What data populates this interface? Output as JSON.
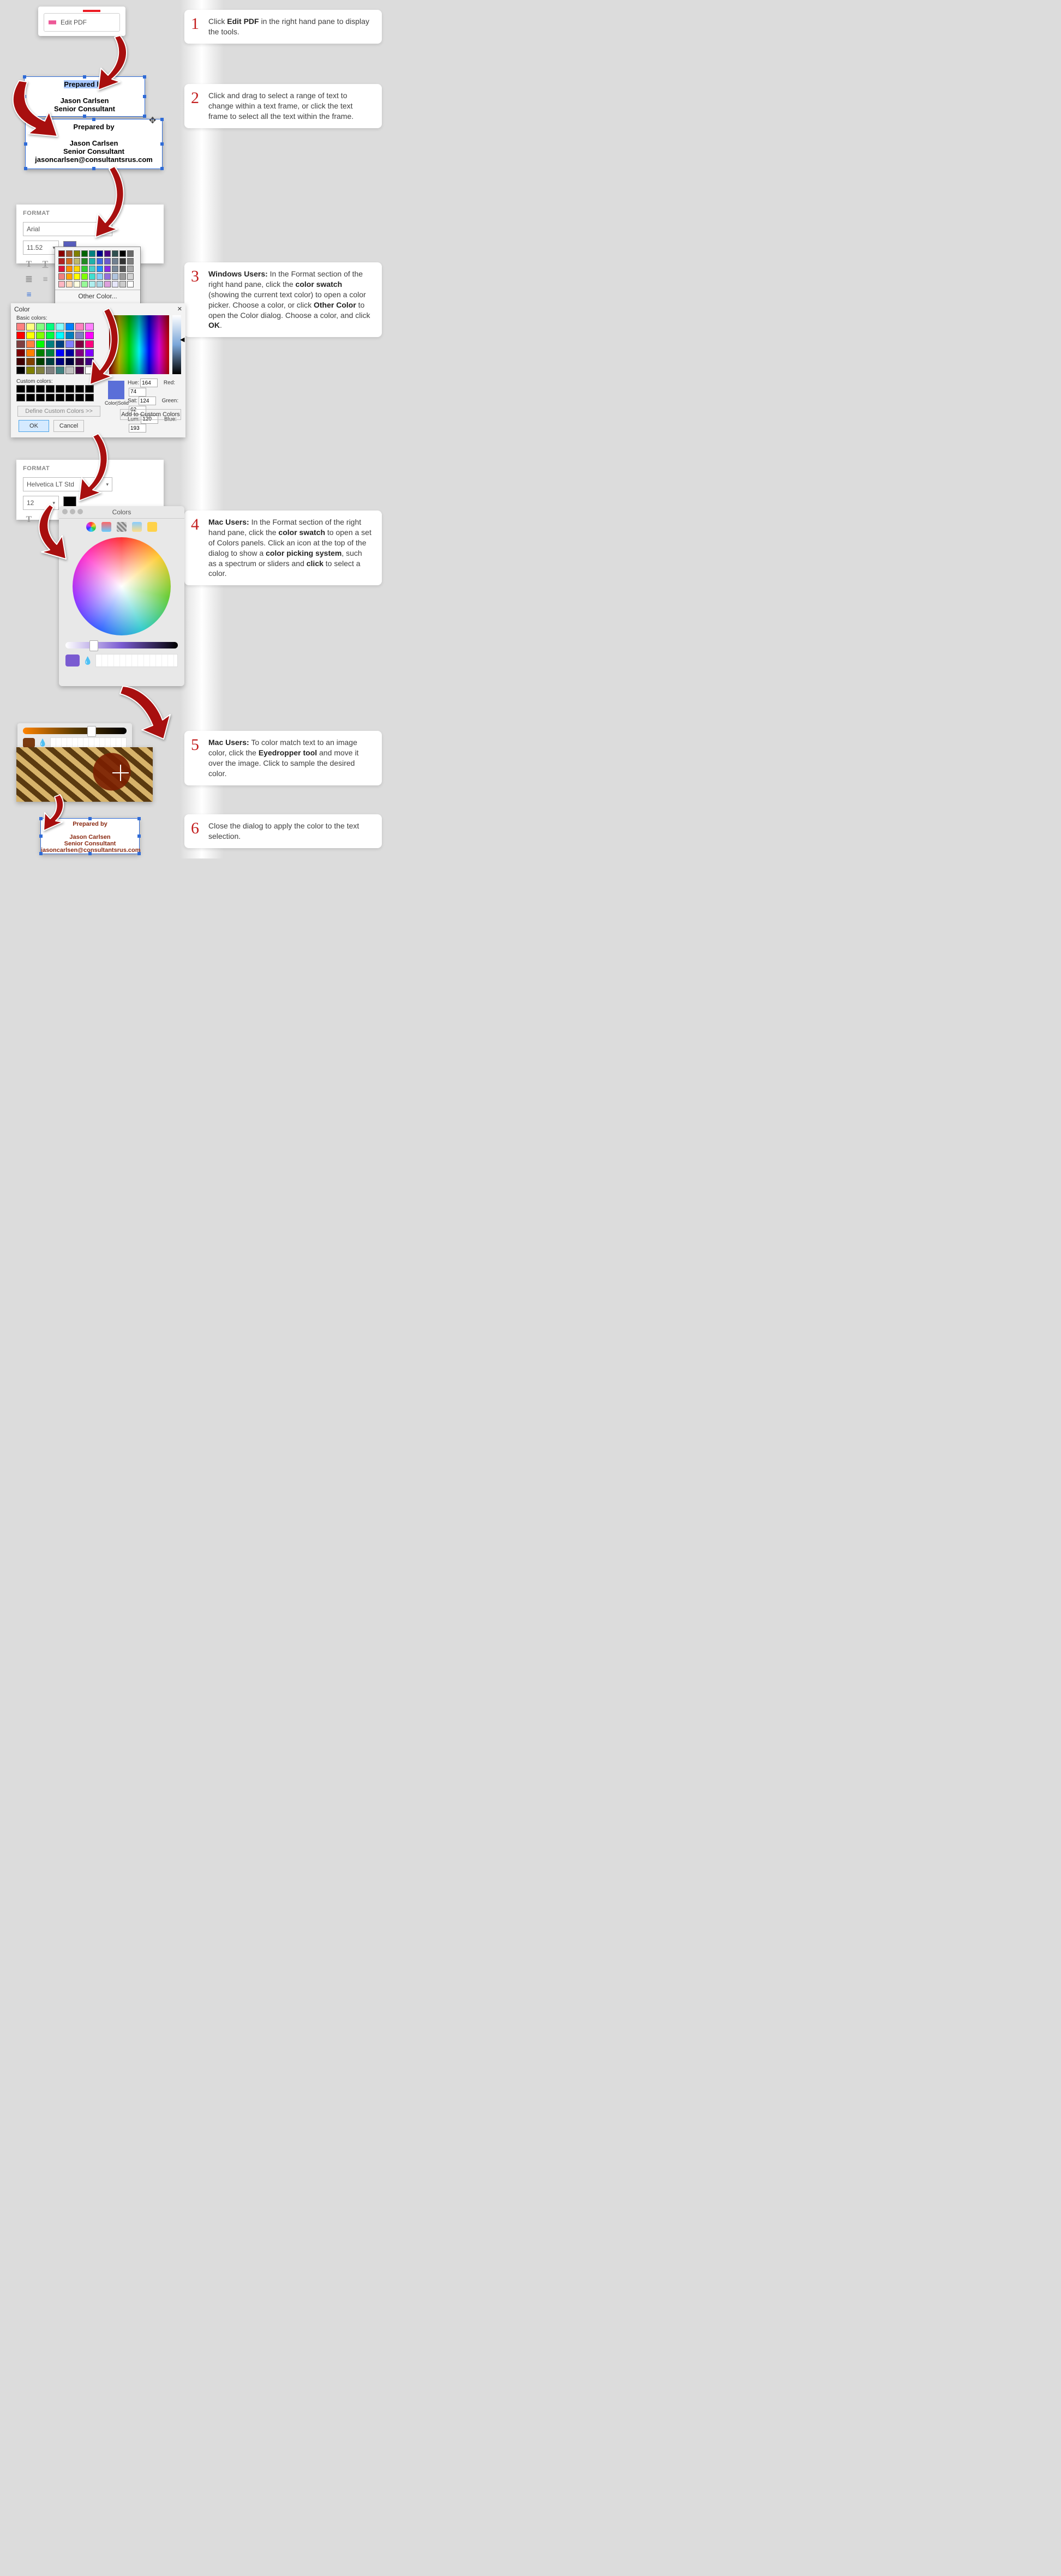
{
  "steps": {
    "s1": {
      "num": "1",
      "t1": "Click ",
      "b1": "Edit PDF",
      "t2": " in the right hand pane to display the tools."
    },
    "s2": {
      "num": "2",
      "t1": "Click and drag to select a range of text to change within a text frame, or click the text frame to select all the text within the frame."
    },
    "s3": {
      "num": "3",
      "b0": "Windows Users:",
      "t1": " In the Format section of the right hand pane, click the ",
      "b1": "color swatch",
      "t2": " (showing the current text color) to open a color picker. Choose a color, or click ",
      "b2": "Other Color",
      "t3": " to open the Color dialog. Choose a color, and click ",
      "b3": "OK",
      "t4": "."
    },
    "s4": {
      "num": "4",
      "b0": "Mac Users:",
      "t1": " In the Format section of the right hand pane, click the ",
      "b1": "color swatch",
      "t2": " to open a set of Colors panels. Click an icon at the top of the dialog to show a ",
      "b2": "color picking system",
      "t3": ", such as a spectrum or sliders and ",
      "b3": "click",
      "t4": " to select a color."
    },
    "s5": {
      "num": "5",
      "b0": "Mac Users:",
      "t1": " To color match text to an image color, click the ",
      "b1": "Eyedropper tool",
      "t2": " and move it over the image. Click to sample the desired color."
    },
    "s6": {
      "num": "6",
      "t1": "Close the dialog to apply the color to the text selection."
    }
  },
  "editpdf": {
    "label": "Edit PDF"
  },
  "tf1": {
    "prepby": "Prepared by",
    "name": "Jason Carlsen",
    "role": "Senior Consultant"
  },
  "tf2": {
    "prepby": "Prepared by",
    "name": "Jason Carlsen",
    "role": "Senior Consultant",
    "email": "jasoncarlsen@consultantsrus.com"
  },
  "final": {
    "prepby": "Prepared by",
    "name": "Jason Carlsen",
    "role": "Senior Consultant",
    "email": "jasoncarlsen@consultantsrus.com"
  },
  "format1": {
    "header": "FORMAT",
    "font": "Arial",
    "size": "11.52",
    "swatch": "#5a5fbf"
  },
  "format2": {
    "header": "FORMAT",
    "font": "Helvetica LT Std",
    "size": "12",
    "swatch": "#000000"
  },
  "acro": {
    "other": "Other Color..."
  },
  "win": {
    "title": "Color",
    "basic_label": "Basic colors:",
    "custom_label": "Custom colors:",
    "define": "Define Custom Colors >>",
    "ok": "OK",
    "cancel": "Cancel",
    "colorsolid": "Color|Solid",
    "add": "Add to Custom Colors",
    "hue_l": "Hue:",
    "sat_l": "Sat:",
    "lum_l": "Lum:",
    "red_l": "Red:",
    "green_l": "Green:",
    "blue_l": "Blue:",
    "hue": "164",
    "sat": "124",
    "lum": "120",
    "red": "74",
    "green": "62",
    "blue": "193",
    "basic_colors": [
      "#ff8080",
      "#ffff80",
      "#80ff80",
      "#00ff80",
      "#80ffff",
      "#0080ff",
      "#ff80c0",
      "#ff80ff",
      "#ff0000",
      "#ffff00",
      "#80ff00",
      "#00ff40",
      "#00ffff",
      "#0080c0",
      "#8080c0",
      "#ff00ff",
      "#804040",
      "#ff8040",
      "#00ff00",
      "#008080",
      "#004080",
      "#8080ff",
      "#800040",
      "#ff0080",
      "#800000",
      "#ff8000",
      "#008000",
      "#008040",
      "#0000ff",
      "#0000a0",
      "#800080",
      "#8000ff",
      "#400000",
      "#804000",
      "#004000",
      "#004040",
      "#000080",
      "#000040",
      "#400040",
      "#400080",
      "#000000",
      "#808000",
      "#808040",
      "#808080",
      "#408080",
      "#c0c0c0",
      "#400040",
      "#ffffff"
    ]
  },
  "mac": {
    "title": "Colors"
  },
  "acro_grid": [
    "#8b0000",
    "#a0522d",
    "#808000",
    "#006400",
    "#008080",
    "#00008b",
    "#4b0082",
    "#2f4f4f",
    "#000000",
    "#696969",
    "#b22222",
    "#d2691e",
    "#bdb76b",
    "#228b22",
    "#20b2aa",
    "#4169e1",
    "#6a5acd",
    "#708090",
    "#333333",
    "#808080",
    "#dc143c",
    "#ff8c00",
    "#ffd700",
    "#32cd32",
    "#48d1cc",
    "#1e90ff",
    "#8a2be2",
    "#778899",
    "#555555",
    "#a9a9a9",
    "#f08080",
    "#ffa500",
    "#ffff00",
    "#7fff00",
    "#40e0d0",
    "#87cefa",
    "#9370db",
    "#b0c4de",
    "#999999",
    "#d3d3d3",
    "#ffb6c1",
    "#ffdab9",
    "#ffffe0",
    "#98fb98",
    "#afeeee",
    "#add8e6",
    "#dda0dd",
    "#e6e6fa",
    "#cccccc",
    "#ffffff"
  ]
}
